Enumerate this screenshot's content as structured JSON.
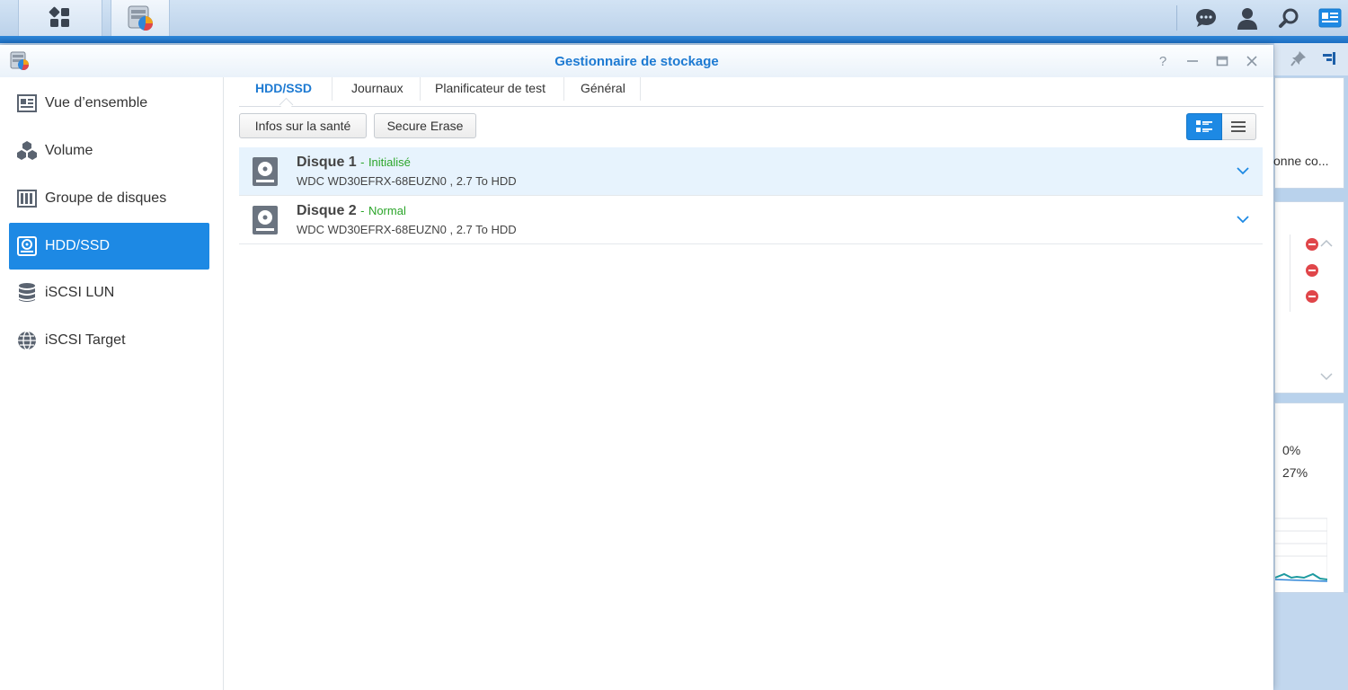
{
  "window": {
    "title": "Gestionnaire de stockage",
    "help_glyph": "?"
  },
  "sidebar": {
    "items": [
      {
        "label": "Vue d’ensemble",
        "icon": "overview-icon"
      },
      {
        "label": "Volume",
        "icon": "volume-cubes-icon"
      },
      {
        "label": "Groupe de disques",
        "icon": "disk-group-icon"
      },
      {
        "label": "HDD/SSD",
        "icon": "hdd-icon",
        "active": true
      },
      {
        "label": "iSCSI LUN",
        "icon": "database-icon"
      },
      {
        "label": "iSCSI Target",
        "icon": "globe-icon"
      }
    ]
  },
  "tabs": [
    {
      "label": "HDD/SSD",
      "active": true
    },
    {
      "label": "Journaux"
    },
    {
      "label": "Planificateur de test"
    },
    {
      "label": "Général"
    }
  ],
  "toolbar": {
    "health_info": "Infos sur la santé",
    "secure_erase": "Secure Erase"
  },
  "disks": [
    {
      "name": "Disque 1",
      "separator": "-",
      "status": "Initialisé",
      "model": "WDC WD30EFRX-68EUZN0 , 2.7 To HDD",
      "selected": true
    },
    {
      "name": "Disque 2",
      "separator": "-",
      "status": "Normal",
      "model": "WDC WD30EFRX-68EUZN0 , 2.7 To HDD",
      "selected": false
    }
  ],
  "background_widgets": {
    "truncated_text": "onne co...",
    "percent_1": "0%",
    "percent_2": "27%"
  },
  "colors": {
    "accent": "#1d89e4",
    "title": "#1d7ad2",
    "status_ok": "#2ba52a",
    "error": "#e0464a"
  }
}
